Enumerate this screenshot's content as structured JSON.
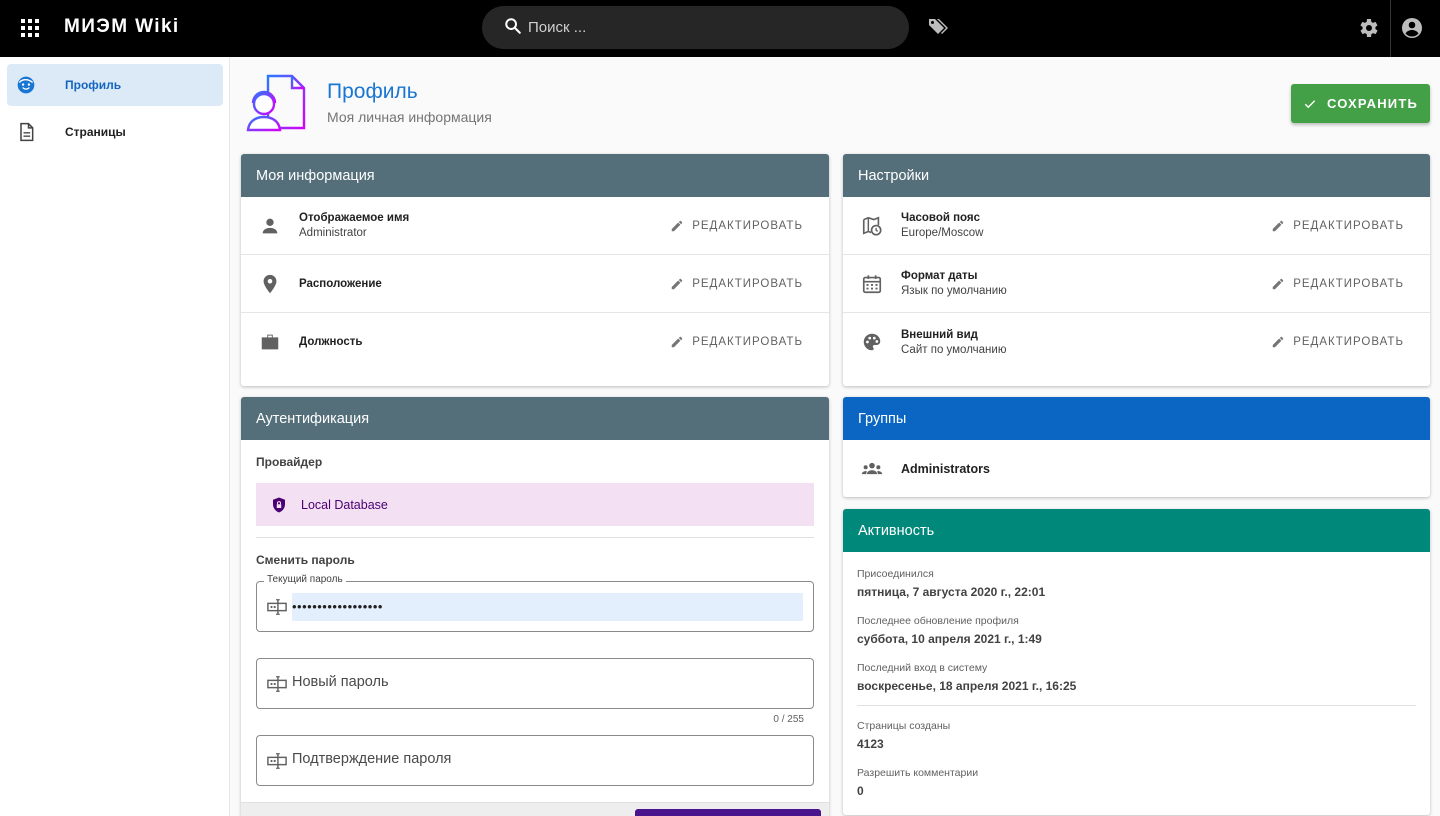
{
  "topbar": {
    "brand": "МИЭМ Wiki",
    "search_placeholder": "Поиск ..."
  },
  "sidebar": {
    "items": [
      {
        "label": "Профиль",
        "icon": "face-icon",
        "active": true
      },
      {
        "label": "Страницы",
        "icon": "document-icon",
        "active": false
      }
    ]
  },
  "header": {
    "title": "Профиль",
    "subtitle": "Моя личная информация",
    "save_label": "СОХРАНИТЬ"
  },
  "my_info": {
    "title": "Моя информация",
    "edit_label": "РЕДАКТИРОВАТЬ",
    "rows": [
      {
        "label": "Отображаемое имя",
        "value": "Administrator",
        "icon": "person-icon"
      },
      {
        "label": "Расположение",
        "value": "",
        "icon": "location-pin-icon"
      },
      {
        "label": "Должность",
        "value": "",
        "icon": "briefcase-icon"
      }
    ]
  },
  "settings": {
    "title": "Настройки",
    "edit_label": "РЕДАКТИРОВАТЬ",
    "rows": [
      {
        "label": "Часовой пояс",
        "value": "Europe/Moscow",
        "icon": "map-clock-icon"
      },
      {
        "label": "Формат даты",
        "value": "Язык по умолчанию",
        "icon": "calendar-icon"
      },
      {
        "label": "Внешний вид",
        "value": "Сайт по умолчанию",
        "icon": "palette-icon"
      }
    ]
  },
  "auth": {
    "title": "Аутентификация",
    "provider_label": "Провайдер",
    "provider": "Local Database",
    "change_password_label": "Сменить пароль",
    "current_password_label": "Текущий пароль",
    "current_password_value": "••••••••••••••••••",
    "new_password_placeholder": "Новый пароль",
    "new_password_counter": "0 / 255",
    "confirm_password_placeholder": "Подтверждение пароля"
  },
  "groups": {
    "title": "Группы",
    "items": [
      "Administrators"
    ]
  },
  "activity": {
    "title": "Активность",
    "joined_label": "Присоединился",
    "joined_value": "пятница, 7 августа 2020 г., 22:01",
    "updated_label": "Последнее обновление профиля",
    "updated_value": "суббота, 10 апреля 2021 г., 1:49",
    "login_label": "Последний вход в систему",
    "login_value": "воскресенье, 18 апреля 2021 г., 16:25",
    "pages_label": "Страницы созданы",
    "pages_value": "4123",
    "comments_label": "Разрешить комментарии",
    "comments_value": "0"
  },
  "colors": {
    "accent": "#1976d2",
    "save": "#43a047",
    "card_header": "#546e7a",
    "groups_header": "#0a66c2",
    "activity_header": "#00897b",
    "provider_bg": "#f3e0f3"
  }
}
